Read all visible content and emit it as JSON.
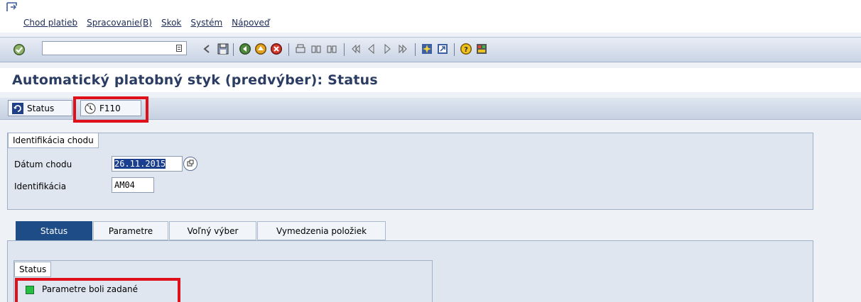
{
  "menu": {
    "items": [
      "Chod platieb",
      "Spracovanie(B)",
      "Skok",
      "Systém",
      "Nápoveď"
    ]
  },
  "toolbar": {
    "command_field": "",
    "icons": [
      "enter-icon",
      "save-icon",
      "back-icon",
      "exit-icon",
      "cancel-icon",
      "print-icon",
      "find-icon",
      "find-next-icon",
      "first-page-icon",
      "prev-page-icon",
      "next-page-icon",
      "last-page-icon",
      "new-session-icon",
      "shortcut-icon",
      "help-icon",
      "layout-icon"
    ]
  },
  "page": {
    "title": "Automatický platobný styk (predvýber): Status"
  },
  "app_toolbar": {
    "status_label": "Status",
    "f110_label": "F110"
  },
  "run_id": {
    "group_title": "Identifikácia chodu",
    "date_label": "Dátum chodu",
    "date_value": "26.11.2015",
    "id_label": "Identifikácia",
    "id_value": "AM04"
  },
  "tabs": [
    "Status",
    "Parametre",
    "Voľný výber",
    "Vymedzenia položiek"
  ],
  "status_group": {
    "title": "Status",
    "message": "Parametre boli zadané"
  },
  "colors": {
    "title": "#2b3d63",
    "highlight": "#e0101a",
    "active_tab": "#1d4c86",
    "led_green": "#25c043"
  }
}
